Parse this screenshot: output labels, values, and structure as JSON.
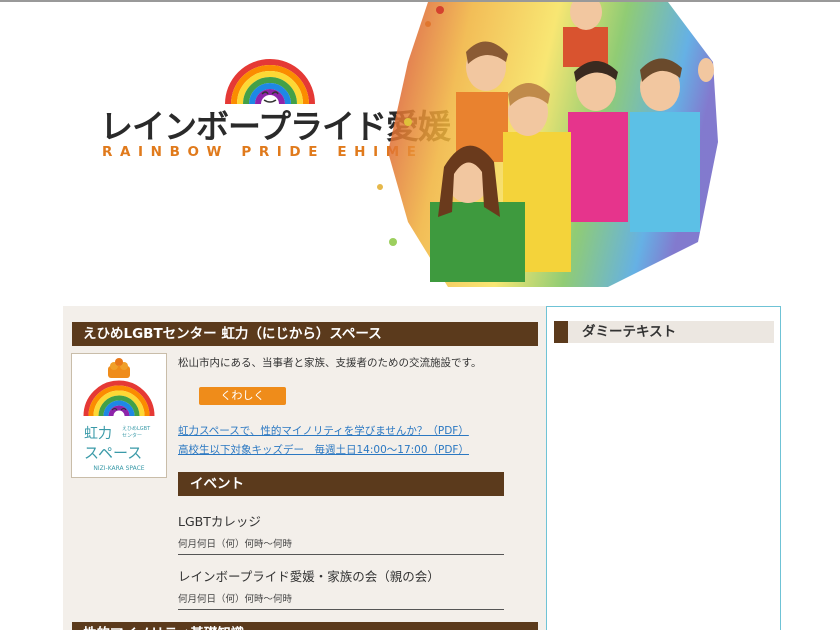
{
  "header": {
    "logo_ja": "レインボープライド愛媛",
    "logo_en": "RAINBOW PRIDE EHIME"
  },
  "main": {
    "section_title": "えひめLGBTセンター 虹力（にじから）スペース",
    "facility_logo": {
      "name": "虹力スペース",
      "tag": "えひめLGBTセンター",
      "en": "NIZI-KARA SPACE"
    },
    "description": "松山市内にある、当事者と家族、支援者のための交流施設です。",
    "more_button": "くわしく",
    "links": [
      "虹力スペースで、性的マイノリティを学びませんか？（PDF）",
      "高校生以下対象キッズデー　毎週土日14:00～17:00（PDF）"
    ],
    "events_title": "イベント",
    "events": [
      {
        "title": "LGBTカレッジ",
        "date": "何月何日（何）何時～何時"
      },
      {
        "title": "レインボープライド愛媛・家族の会（親の会）",
        "date": "何月何日（何）何時～何時"
      }
    ],
    "next_section_title": "性的マイノリティ基礎知識"
  },
  "sidebar": {
    "title": "ダミーテキスト"
  },
  "colors": {
    "brown": "#5b3a1c",
    "orange": "#ef8c1a",
    "link": "#2b78c2",
    "panel_bg": "#f3efea",
    "sidebar_border": "#6fc3d6"
  }
}
